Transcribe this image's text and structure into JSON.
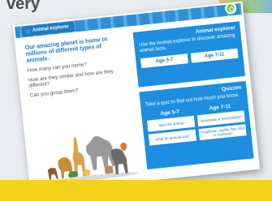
{
  "page": {
    "heading_fragment": "very"
  },
  "card": {
    "tab_label": "Animal explorer",
    "intro": "Our amazing planet is home to millions of different types of animals.",
    "questions": [
      "How many can you name?",
      "How are they similar and how are they different?",
      "Can you group them?"
    ]
  },
  "explorer_panel": {
    "title": "Animal explorer",
    "text": "Use the Animal explorer to discover amazing animal facts.",
    "buttons": [
      "Age 5-7",
      "Age 7-11"
    ]
  },
  "quiz_panel": {
    "title": "Quizzes",
    "text": "Take a quiz to find out how much you know.",
    "columns": [
      {
        "heading": "Age 5-7",
        "buttons": [
          "Spot the animal",
          "What do animals eat?"
        ]
      },
      {
        "heading": "Age 7-11",
        "buttons": [
          "Vertebrate or invertebrate?",
          "Amphibian, reptile, fish, bird or mammal?"
        ]
      }
    ]
  },
  "colors": {
    "brand_blue": "#1d8ee0",
    "bottom_stripe": "#f3d21b",
    "logo_green": "#7ac943"
  }
}
